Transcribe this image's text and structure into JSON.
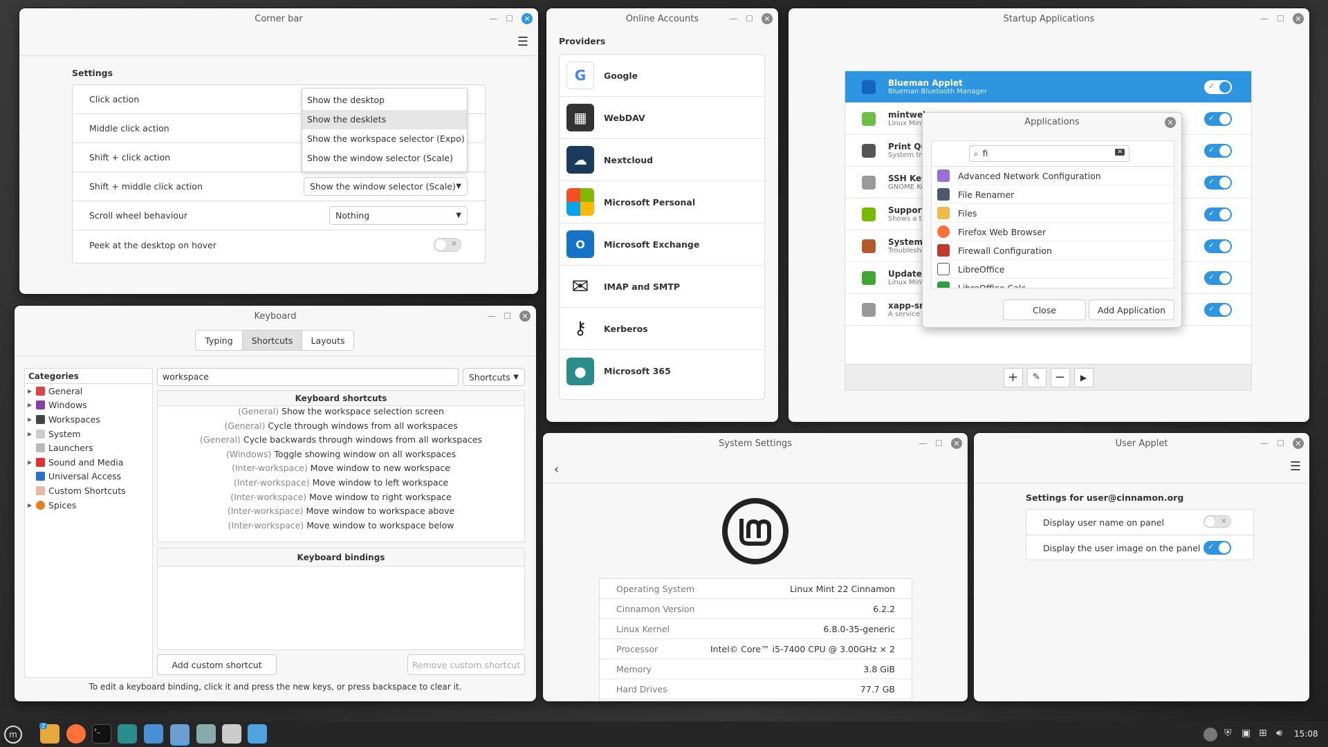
{
  "corner_bar": {
    "title": "Corner bar",
    "settings_heading": "Settings",
    "rows": [
      {
        "label": "Click action"
      },
      {
        "label": "Middle click action"
      },
      {
        "label": "Shift + click action"
      },
      {
        "label": "Shift + middle click action",
        "value": "Show the window selector (Scale)"
      },
      {
        "label": "Scroll wheel behaviour",
        "value": "Nothing"
      },
      {
        "label": "Peek at the desktop on hover"
      }
    ],
    "dropdown_options": [
      "Show the desktop",
      "Show the desklets",
      "Show the workspace selector (Expo)",
      "Show the window selector (Scale)"
    ],
    "selected_option": "Show the desklets"
  },
  "online_accounts": {
    "title": "Online Accounts",
    "heading": "Providers",
    "providers": [
      "Google",
      "WebDAV",
      "Nextcloud",
      "Microsoft Personal",
      "Microsoft Exchange",
      "IMAP and SMTP",
      "Kerberos",
      "Microsoft 365"
    ]
  },
  "startup": {
    "title": "Startup Applications",
    "items": [
      {
        "title": "Blueman Applet",
        "sub": "Blueman Bluetooth Manager"
      },
      {
        "title": "mintwelcome",
        "sub": "Linux Mint"
      },
      {
        "title": "Print Qu",
        "sub": "System tra"
      },
      {
        "title": "SSH Key",
        "sub": "GNOME Ke"
      },
      {
        "title": "Support",
        "sub": "Shows a tr"
      },
      {
        "title": "System R",
        "sub": "Troublesho"
      },
      {
        "title": "Update M",
        "sub": "Linux Mint"
      },
      {
        "title": "xapp-sn-",
        "sub": "A service t"
      }
    ]
  },
  "applications_dialog": {
    "title": "Applications",
    "search_value": "fi",
    "apps": [
      "Advanced Network Configuration",
      "File Renamer",
      "Files",
      "Firefox Web Browser",
      "Firewall Configuration",
      "LibreOffice",
      "LibreOffice Calc"
    ],
    "close_label": "Close",
    "add_label": "Add Application"
  },
  "keyboard": {
    "title": "Keyboard",
    "tabs": [
      "Typing",
      "Shortcuts",
      "Layouts"
    ],
    "active_tab": "Shortcuts",
    "categories_header": "Categories",
    "categories": [
      "General",
      "Windows",
      "Workspaces",
      "System",
      "Launchers",
      "Sound and Media",
      "Universal Access",
      "Custom Shortcuts",
      "Spices"
    ],
    "search_value": "workspace",
    "filter_label": "Shortcuts",
    "shortcuts_header": "Keyboard shortcuts",
    "shortcuts": [
      {
        "cat": "(General)",
        "text": "Show the workspace selection screen"
      },
      {
        "cat": "(General)",
        "text": "Cycle through windows from all workspaces"
      },
      {
        "cat": "(General)",
        "text": "Cycle backwards through windows from all workspaces"
      },
      {
        "cat": "(Windows)",
        "text": "Toggle showing window on all workspaces"
      },
      {
        "cat": "(Inter-workspace)",
        "text": "Move window to new workspace"
      },
      {
        "cat": "(Inter-workspace)",
        "text": "Move window to left workspace"
      },
      {
        "cat": "(Inter-workspace)",
        "text": "Move window to right workspace"
      },
      {
        "cat": "(Inter-workspace)",
        "text": "Move window to workspace above"
      },
      {
        "cat": "(Inter-workspace)",
        "text": "Move window to workspace below"
      }
    ],
    "bindings_header": "Keyboard bindings",
    "add_label": "Add custom shortcut",
    "remove_label": "Remove custom shortcut",
    "footer": "To edit a keyboard binding, click it and press the new keys, or press backspace to clear it."
  },
  "system_settings": {
    "title": "System Settings",
    "info": [
      {
        "k": "Operating System",
        "v": "Linux Mint 22 Cinnamon"
      },
      {
        "k": "Cinnamon Version",
        "v": "6.2.2"
      },
      {
        "k": "Linux Kernel",
        "v": "6.8.0-35-generic"
      },
      {
        "k": "Processor",
        "v": "Intel© Core™ i5-7400 CPU @ 3.00GHz × 2"
      },
      {
        "k": "Memory",
        "v": "3.8 GiB"
      },
      {
        "k": "Hard Drives",
        "v": "77.7 GB"
      }
    ]
  },
  "user_applet": {
    "title": "User Applet",
    "heading": "Settings for user@cinnamon.org",
    "rows": [
      {
        "label": "Display user name on panel",
        "on": false
      },
      {
        "label": "Display the user image on the panel",
        "on": true
      }
    ]
  },
  "taskbar": {
    "clock": "15:08",
    "workspace_badge": "2"
  }
}
